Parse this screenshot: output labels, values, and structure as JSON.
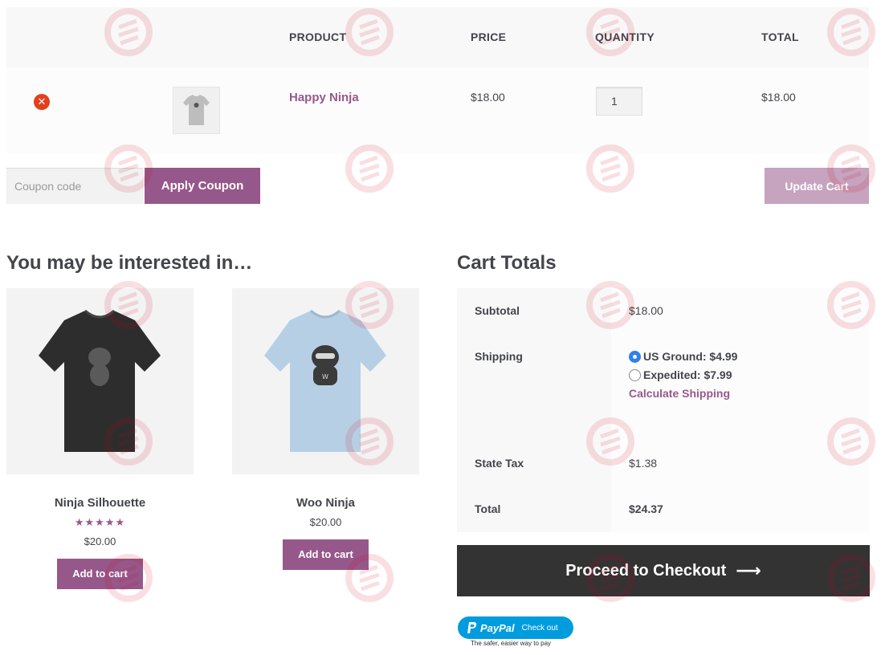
{
  "cart": {
    "headers": {
      "product": "PRODUCT",
      "price": "PRICE",
      "quantity": "QUANTITY",
      "total": "TOTAL"
    },
    "items": [
      {
        "name": "Happy Ninja",
        "price": "$18.00",
        "quantity": "1",
        "total": "$18.00"
      }
    ],
    "coupon_placeholder": "Coupon code",
    "apply_coupon_label": "Apply Coupon",
    "update_cart_label": "Update Cart"
  },
  "cross_sells": {
    "title": "You may be interested in…",
    "products": [
      {
        "name": "Ninja Silhouette",
        "price": "$20.00",
        "rating": "★★★★★",
        "rating_value": 5,
        "add_label": "Add to cart"
      },
      {
        "name": "Woo Ninja",
        "price": "$20.00",
        "add_label": "Add to cart"
      }
    ]
  },
  "totals": {
    "title": "Cart Totals",
    "subtotal_label": "Subtotal",
    "subtotal_value": "$18.00",
    "shipping_label": "Shipping",
    "shipping_options": [
      {
        "label": "US Ground: $4.99",
        "selected": true
      },
      {
        "label": "Expedited: $7.99",
        "selected": false
      }
    ],
    "calculate_shipping": "Calculate Shipping",
    "tax_label": "State Tax",
    "tax_value": "$1.38",
    "total_label": "Total",
    "total_value": "$24.37",
    "checkout_label": "Proceed to Checkout",
    "checkout_arrow": "⟶"
  },
  "paypal": {
    "brand": "PayPal",
    "checkout_text": "Check out",
    "tagline": "The safer, easier way to pay"
  },
  "colors": {
    "accent": "#96588a",
    "remove": "#e2401c",
    "checkout_bg": "#333333",
    "paypal": "#009cde"
  }
}
